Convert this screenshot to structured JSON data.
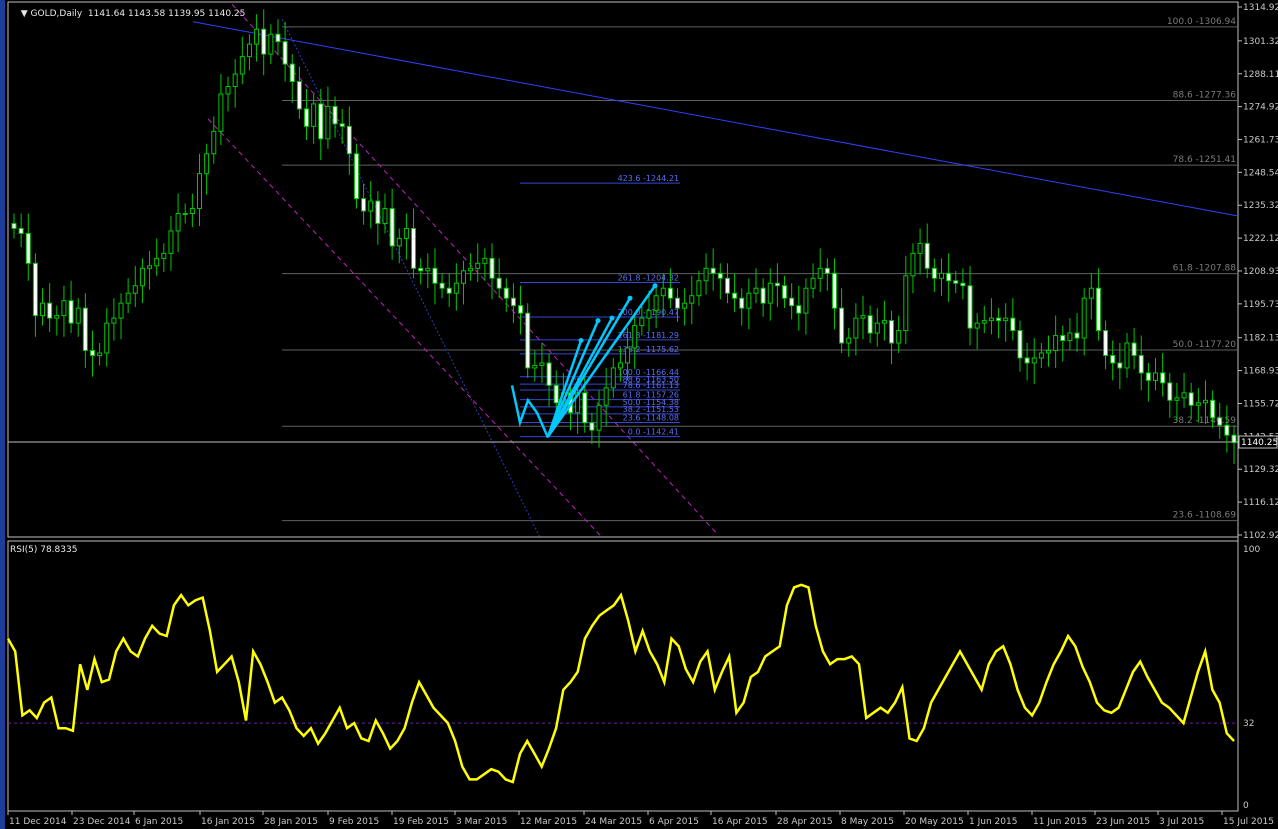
{
  "symbol_header": {
    "symbol": "GOLD,Daily",
    "values": "1141.64 1143.58 1139.95 1140.25"
  },
  "rsi_header": {
    "label": "RSI(5) 78.8335"
  },
  "price_axis": {
    "ticks": [
      "1314.92",
      "1301.32",
      "1288.11",
      "1274.92",
      "1261.73",
      "1248.54",
      "1235.32",
      "1222.12",
      "1208.93",
      "1195.73",
      "1182.13",
      "1168.93",
      "1155.72",
      "1142.53",
      "1129.32",
      "1116.12",
      "1102.92"
    ],
    "current_price_label": "1140.25"
  },
  "rsi_axis": {
    "ticks": [
      "100",
      "32",
      "0"
    ]
  },
  "time_axis": {
    "labels": [
      "11 Dec 2014",
      "23 Dec 2014",
      "6 Jan 2015",
      "16 Jan 2015",
      "28 Jan 2015",
      "9 Feb 2015",
      "19 Feb 2015",
      "3 Mar 2015",
      "12 Mar 2015",
      "24 Mar 2015",
      "6 Apr 2015",
      "16 Apr 2015",
      "28 Apr 2015",
      "8 May 2015",
      "20 May 2015",
      "1 Jun 2015",
      "11 Jun 2015",
      "23 Jun 2015",
      "3 Jul 2015",
      "15 Jul 2015"
    ]
  },
  "fib_retracement_labels": [
    "100.0 -1306.94",
    "88.6 -1277.36",
    "78.6 -1251.41",
    "61.8 -1207.88",
    "50.0 -1177.20",
    "38.2 -1146.59",
    "23.6 -1108.69"
  ],
  "fib_extension_labels": [
    "423.6 -1244.21",
    "261.8 -1204.32",
    "200.0 -1190.47",
    "161.8 -1181.29",
    "138.2 -1175.62",
    "100.0 -1166.44",
    "88.6 -1163.50",
    "78.6 -1161.13",
    "61.8 -1157.26",
    "50.0 -1154.38",
    "38.2 -1151.53",
    "23.6 -1148.08",
    "0.0 -1142.41"
  ],
  "colors": {
    "background": "#000000",
    "bull_candle": "#00c800",
    "bear_candle_body": "#ffffff",
    "rsi_line": "#ffff00",
    "trendline": "#3040ff",
    "channel": "#c020c0",
    "fib_level": "#606060",
    "arrows": "#00c8ff"
  },
  "chart_data": [
    {
      "type": "candlestick",
      "title": "GOLD,Daily",
      "x_start": "11 Dec 2014",
      "x_end": "15 Jul 2015",
      "ylim": [
        1102.92,
        1314.92
      ],
      "close": [
        1226,
        1224,
        1212,
        1191,
        1196,
        1190,
        1191,
        1197,
        1188,
        1194,
        1177,
        1175,
        1176,
        1188,
        1190,
        1196,
        1200,
        1203,
        1210,
        1211,
        1214,
        1216,
        1225,
        1232,
        1232,
        1234,
        1248,
        1256,
        1265,
        1280,
        1283,
        1288,
        1295,
        1300,
        1306,
        1296,
        1304,
        1301,
        1292,
        1285,
        1274,
        1267,
        1276,
        1262,
        1275,
        1268,
        1267,
        1256,
        1238,
        1233,
        1237,
        1228,
        1234,
        1219,
        1222,
        1226,
        1210,
        1209,
        1210,
        1204,
        1202,
        1200,
        1204,
        1209,
        1210,
        1212,
        1214,
        1206,
        1202,
        1198,
        1195,
        1192,
        1170,
        1171,
        1172,
        1163,
        1156,
        1160,
        1152,
        1160,
        1148,
        1145,
        1155,
        1162,
        1170,
        1172,
        1178,
        1187,
        1190,
        1193,
        1199,
        1202,
        1198,
        1194,
        1196,
        1199,
        1205,
        1210,
        1208,
        1206,
        1200,
        1198,
        1194,
        1200,
        1202,
        1196,
        1204,
        1203,
        1198,
        1195,
        1192,
        1202,
        1206,
        1210,
        1208,
        1194,
        1180,
        1182,
        1190,
        1191,
        1184,
        1188,
        1189,
        1180,
        1185,
        1207,
        1216,
        1220,
        1210,
        1206,
        1208,
        1205,
        1204,
        1203,
        1186,
        1188,
        1189,
        1190,
        1189,
        1190,
        1185,
        1174,
        1172,
        1174,
        1176,
        1177,
        1183,
        1181,
        1184,
        1182,
        1198,
        1202,
        1185,
        1175,
        1172,
        1170,
        1180,
        1175,
        1168,
        1165,
        1168,
        1164,
        1157,
        1158,
        1160,
        1155,
        1156,
        1157,
        1150,
        1147,
        1143,
        1140
      ]
    },
    {
      "type": "line",
      "title": "RSI(5) 78.8335",
      "ylim": [
        0,
        100
      ],
      "reference_level": 32,
      "values": [
        65,
        60,
        35,
        37,
        34,
        40,
        42,
        30,
        30,
        29,
        55,
        45,
        57,
        48,
        49,
        60,
        65,
        60,
        58,
        65,
        70,
        67,
        66,
        78,
        82,
        78,
        80,
        81,
        68,
        52,
        55,
        58,
        48,
        33,
        60,
        55,
        48,
        40,
        42,
        37,
        30,
        27,
        30,
        24,
        28,
        33,
        38,
        30,
        32,
        26,
        25,
        33,
        28,
        22,
        25,
        30,
        40,
        48,
        43,
        38,
        35,
        32,
        25,
        15,
        10,
        10,
        12,
        14,
        13,
        10,
        9,
        20,
        25,
        20,
        15,
        22,
        30,
        45,
        48,
        52,
        65,
        70,
        74,
        76,
        78,
        82,
        72,
        60,
        68,
        60,
        55,
        48,
        65,
        62,
        53,
        48,
        56,
        60,
        45,
        52,
        58,
        36,
        40,
        50,
        52,
        58,
        60,
        62,
        78,
        85,
        86,
        85,
        70,
        60,
        55,
        57,
        57,
        58,
        55,
        34,
        36,
        38,
        36,
        40,
        46,
        26,
        25,
        30,
        40,
        45,
        50,
        55,
        60,
        55,
        50,
        45,
        55,
        60,
        62,
        55,
        45,
        38,
        35,
        40,
        48,
        55,
        60,
        66,
        62,
        54,
        48,
        40,
        37,
        36,
        38,
        45,
        52,
        56,
        50,
        45,
        40,
        38,
        35,
        32,
        42,
        52,
        60,
        45,
        40,
        28,
        25
      ]
    }
  ]
}
